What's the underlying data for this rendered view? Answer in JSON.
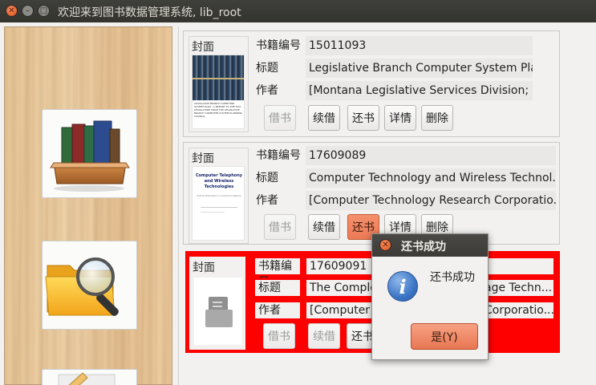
{
  "window": {
    "title": "欢迎来到图书数据管理系统, lib_root"
  },
  "sidebar": {
    "tiles": [
      {
        "icon": "books-in-tray-icon"
      },
      {
        "icon": "folder-search-icon"
      },
      {
        "icon": "edit-document-icon"
      }
    ]
  },
  "labels": {
    "cover": "封面",
    "isbn": "书籍编号",
    "title": "标题",
    "author": "作者"
  },
  "actions": {
    "borrow": "借书",
    "renew": "续借",
    "return": "还书",
    "details": "详情",
    "delete": "删除"
  },
  "books": [
    {
      "id": "15011093",
      "title": "Legislative Branch Computer System Plan",
      "author": "[Montana Legislative Services Division; ...",
      "cover_text": "LEGISLATIVE BRANCH COMPUTER SYSTEM PLAN - A REPORT TO THE 57th LEGISLATURE FROM THE LEGISLATIVE BRANCH COMPUTER SYSTEM PLANNING COUNCIL"
    },
    {
      "id": "17609089",
      "title": "Computer Technology and Wireless Technol...",
      "author": "[Computer Technology Research Corporatio...",
      "cover_title": "Computer Telephony and Wireless Technologies",
      "cover_sub": "Future Directions in Communications"
    },
    {
      "id": "17609091",
      "title": "The Comple",
      "title_tail": "age Techn...",
      "author": "[Computer T",
      "author_tail": "Corporatio..."
    }
  ],
  "dialog": {
    "title": "还书成功",
    "message": "还书成功",
    "ok_label": "是(Y)",
    "icon": "info-icon"
  },
  "colors": {
    "selected_card": "#ff0000",
    "accent_button": "#ec7a55",
    "titlebar": "#3c3b37"
  }
}
